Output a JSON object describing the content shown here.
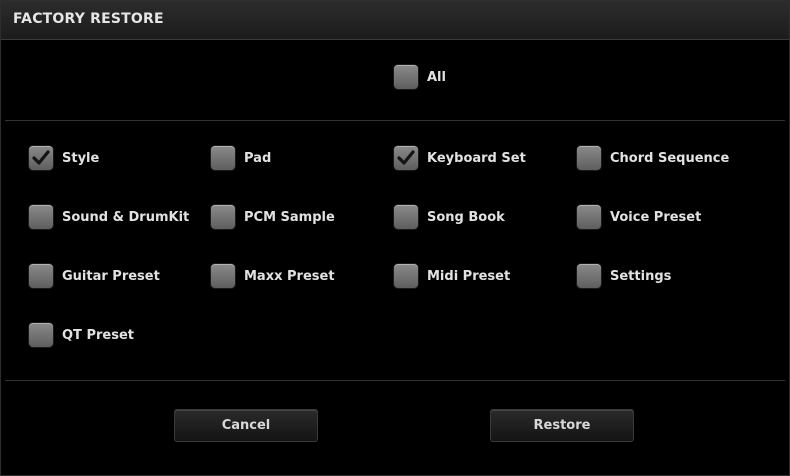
{
  "title": "FACTORY RESTORE",
  "all": {
    "label": "All",
    "checked": false
  },
  "options": [
    {
      "label": "Style",
      "checked": true
    },
    {
      "label": "Pad",
      "checked": false
    },
    {
      "label": "Keyboard Set",
      "checked": true
    },
    {
      "label": "Chord Sequence",
      "checked": false
    },
    {
      "label": "Sound & DrumKit",
      "checked": false
    },
    {
      "label": "PCM Sample",
      "checked": false
    },
    {
      "label": "Song Book",
      "checked": false
    },
    {
      "label": "Voice Preset",
      "checked": false
    },
    {
      "label": "Guitar Preset",
      "checked": false
    },
    {
      "label": "Maxx Preset",
      "checked": false
    },
    {
      "label": "Midi Preset",
      "checked": false
    },
    {
      "label": "Settings",
      "checked": false
    },
    {
      "label": "QT Preset",
      "checked": false
    }
  ],
  "buttons": {
    "cancel": "Cancel",
    "restore": "Restore"
  }
}
